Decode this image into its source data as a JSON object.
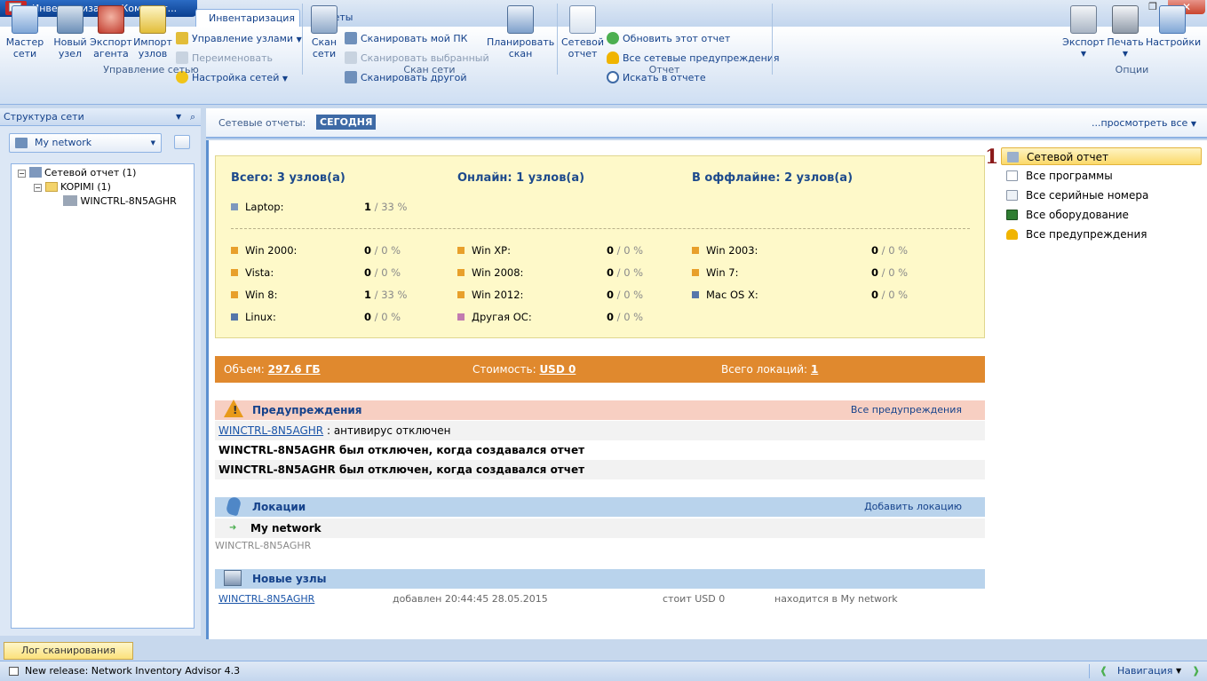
{
  "window": {
    "app_title": "Инвентаризация Компьют...",
    "tabs": [
      "Инвентаризация",
      "Отчеты"
    ]
  },
  "ribbon": {
    "group_manage": {
      "label": "Управление сетью",
      "wizard": "Мастер\nсети",
      "new_node": "Новый\nузел",
      "export_agent": "Экспорт\nагента",
      "import_nodes": "Импорт\nузлов",
      "manage_nodes": "Управление узлами",
      "rename": "Переименовать",
      "network_settings": "Настройка сетей"
    },
    "group_scan": {
      "label": "Скан сети",
      "scan_network": "Скан\nсети",
      "scan_my_pc": "Сканировать мой ПК",
      "scan_selected": "Сканировать выбранный",
      "scan_other": "Сканировать другой",
      "plan_scan": "Планировать\nскан"
    },
    "group_report": {
      "label": "Отчет",
      "net_report": "Сетевой\nотчет",
      "refresh": "Обновить этот отчет",
      "all_warnings": "Все сетевые предупреждения",
      "search": "Искать в отчете"
    },
    "group_options": {
      "label": "Опции",
      "export": "Экспорт",
      "print": "Печать",
      "settings": "Настройки"
    }
  },
  "left_panel": {
    "title": "Структура сети",
    "network_select": "My network",
    "tree": [
      {
        "label": "Сетевой отчет (1)"
      },
      {
        "label": "KOPIMI (1)"
      },
      {
        "label": "WINCTRL-8N5AGHR"
      }
    ]
  },
  "main_top": {
    "label": "Сетевые отчеты:",
    "badge": "СЕГОДНЯ",
    "view_all": "...просмотреть все"
  },
  "summary": {
    "total": "Всего: 3 узлов(а)",
    "online": "Онлайн: 1 узлов(а)",
    "offline": "В оффлайне: 2 узлов(а)",
    "laptop": {
      "name": "Laptop:",
      "count": "1",
      "pct": " / 33 %"
    },
    "os": [
      {
        "name": "Win 2000:",
        "count": "0",
        "pct": " / 0 %",
        "color": "#e8a02b"
      },
      {
        "name": "Win XP:",
        "count": "0",
        "pct": " / 0 %",
        "color": "#e8a02b"
      },
      {
        "name": "Win 2003:",
        "count": "0",
        "pct": " / 0 %",
        "color": "#e8a02b"
      },
      {
        "name": "Vista:",
        "count": "0",
        "pct": " / 0 %",
        "color": "#e8a02b"
      },
      {
        "name": "Win 2008:",
        "count": "0",
        "pct": " / 0 %",
        "color": "#e8a02b"
      },
      {
        "name": "Win 7:",
        "count": "0",
        "pct": " / 0 %",
        "color": "#e8a02b"
      },
      {
        "name": "Win 8:",
        "count": "1",
        "pct": " / 33 %",
        "color": "#e8a02b"
      },
      {
        "name": "Win 2012:",
        "count": "0",
        "pct": " / 0 %",
        "color": "#e8a02b"
      },
      {
        "name": "Mac OS X:",
        "count": "0",
        "pct": " / 0 %",
        "color": "#5577aa"
      },
      {
        "name": "Linux:",
        "count": "0",
        "pct": " / 0 %",
        "color": "#5577aa"
      },
      {
        "name": "Другая ОС:",
        "count": "0",
        "pct": " / 0 %",
        "color": "#c27bb0"
      }
    ]
  },
  "stats": {
    "volume_label": "Объем:",
    "volume": "297.6 ГБ",
    "cost_label": "Стоимость:",
    "cost": "USD 0",
    "locations_label": "Всего локаций:",
    "locations": "1"
  },
  "warnings": {
    "title": "Предупреждения",
    "all_link": "Все предупреждения",
    "rows": [
      {
        "host": "WINCTRL-8N5AGHR",
        "text": " : антивирус отключен"
      },
      {
        "text": "WINCTRL-8N5AGHR был отключен, когда создавался отчет"
      },
      {
        "text": "WINCTRL-8N5AGHR был отключен, когда создавался отчет"
      }
    ]
  },
  "locations": {
    "title": "Локации",
    "add_link": "Добавить локацию",
    "name": "My network",
    "host": "WINCTRL-8N5AGHR"
  },
  "new_nodes": {
    "title": "Новые узлы",
    "host": "WINCTRL-8N5AGHR",
    "added": "добавлен 20:44:45 28.05.2015",
    "cost": "стоит USD 0",
    "location": "находится в My network"
  },
  "right_links": {
    "marker": "1",
    "items": [
      "Сетевой отчет",
      "Все программы",
      "Все серийные номера",
      "Все оборудование",
      "Все предупреждения"
    ]
  },
  "bottom": {
    "log_tab": "Лог сканирования",
    "status": "New release: Network Inventory Advisor 4.3",
    "navigation": "Навигация"
  }
}
